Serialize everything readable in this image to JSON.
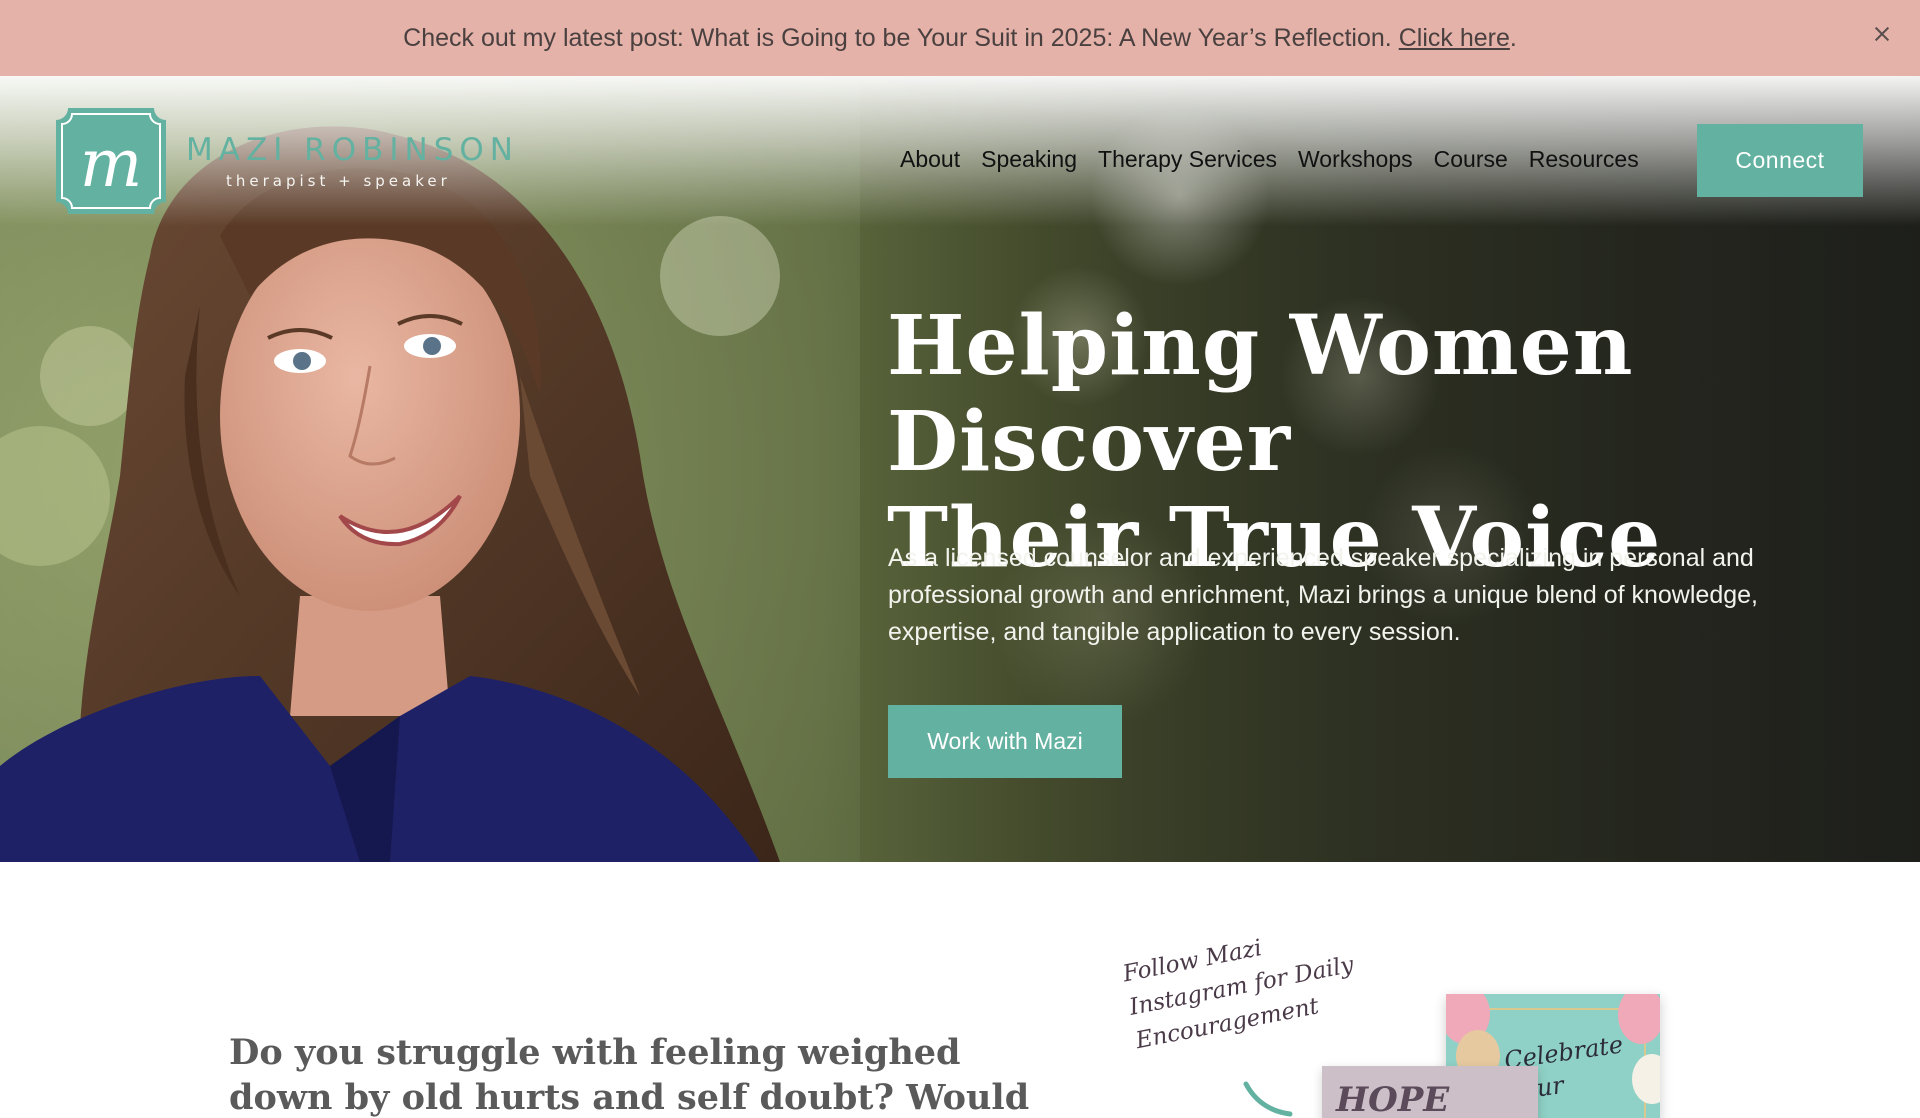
{
  "announcement": {
    "text": "Check out my latest post: What is Going to be Your Suit in 2025: A New Year’s Reflection.",
    "link_label": "Click here",
    "trailing": "."
  },
  "brand": {
    "logo_letter": "m",
    "name": "MAZI ROBINSON",
    "tagline": "therapist + speaker",
    "accent": "#63b1a0"
  },
  "nav": {
    "items": [
      "About",
      "Speaking",
      "Therapy Services",
      "Workshops",
      "Course",
      "Resources"
    ],
    "cta_label": "Connect"
  },
  "hero": {
    "headline_line1": "Helping Women Discover",
    "headline_line2_plain": "Their ",
    "headline_line2_bold": "True Voice",
    "description": "As a licensed counselor and experienced speaker specializing in personal and professional growth and enrichment, Mazi brings a unique blend of knowledge, expertise, and tangible application to every session.",
    "cta_label": "Work with Mazi"
  },
  "intro": {
    "question": "Do you struggle with feeling weighed down by old hurts and self doubt? Would you like to cultivate",
    "follow_text": "Follow Mazi Instagram for Daily Encouragement",
    "card_hope": "HOPE",
    "card_celebrate": "Celebrate Your"
  },
  "colors": {
    "announcement_bg": "#e4b2a8",
    "button": "#63b1a0"
  }
}
